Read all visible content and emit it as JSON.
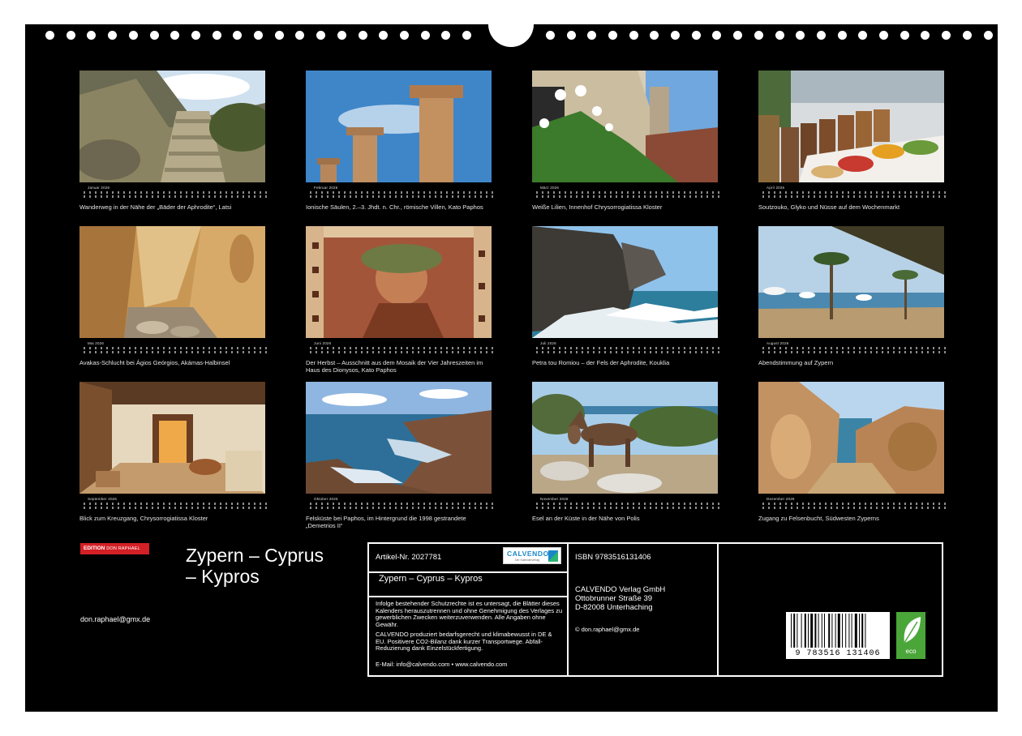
{
  "months": [
    {
      "name": "Januar 2026",
      "caption": "Wanderweg in der Nähe der „Bäder der Aphrodite“, Latsi"
    },
    {
      "name": "Februar 2026",
      "caption": "Ionische Säulen, 2.–3. Jhdt. n. Chr., römische Villen, Kato Paphos"
    },
    {
      "name": "März 2026",
      "caption": "Weiße Lilien, Innenhof Chrysorrogiatissa Kloster"
    },
    {
      "name": "April 2026",
      "caption": "Soutzouko, Glyko und Nüsse auf dem Wochenmarkt"
    },
    {
      "name": "Mai 2026",
      "caption": "Avakas-Schlucht bei Ágios Geórgios, Akámas-Halbinsel"
    },
    {
      "name": "Juni 2026",
      "caption": "Der Herbst – Ausschnitt aus dem Mosaik der Vier Jahreszeiten im Haus des Dionysos, Kato Paphos"
    },
    {
      "name": "Juli 2026",
      "caption": "Petra tou Romiou – der Fels der Aphrodite, Kouklia"
    },
    {
      "name": "August 2026",
      "caption": "Abendstimmung auf Zypern"
    },
    {
      "name": "September 2026",
      "caption": "Blick zum Kreuzgang, Chrysorrogiatissa Kloster"
    },
    {
      "name": "Oktober 2026",
      "caption": "Felsküste bei Paphos, im Hintergrund die 1998 gestrandete „Demetrios II“"
    },
    {
      "name": "November 2026",
      "caption": "Esel an der Küste in der Nähe von Polis"
    },
    {
      "name": "Dezember 2026",
      "caption": "Zugang zu Felsenbucht, Südwesten Zyperns"
    }
  ],
  "cover": {
    "badge_edition": "EDITION",
    "badge_author": "DON RAPHAEL",
    "title": "Zypern – Cyprus\n– Kypros",
    "email": "don.raphael@gmx.de"
  },
  "info": {
    "article_no": "Artikel-Nr. 2027781",
    "logo_text": "CALVENDO",
    "logo_sub": "Der Kalenderverlag",
    "title": "Zypern – Cyprus – Kypros",
    "legal_1": "Infolge bestehender Schutzrechte ist es untersagt, die Blätter dieses Kalenders herauszutrennen und ohne Genehmigung des Verlages zu gewerblichen Zwecken weiterzuverwenden. Alle Angaben ohne Gewähr.",
    "legal_2": "CALVENDO produziert bedarfsgerecht und klimabewusst in DE & EU. Positivere CO2-Bilanz dank kurzer Transportwege. Abfall-Reduzierung dank Einzelstückfertigung.",
    "contact": "E-Mail: info@calvendo.com • www.calvendo.com",
    "isbn": "ISBN 9783516131406",
    "publisher_name": "CALVENDO Verlag GmbH",
    "publisher_street": "Ottobrunner Straße 39",
    "publisher_city": "D-82008 Unterhaching",
    "copyright": "© don.raphael@gmx.de",
    "barcode_digits": "9 783516 131406",
    "eco_label": "eco"
  }
}
